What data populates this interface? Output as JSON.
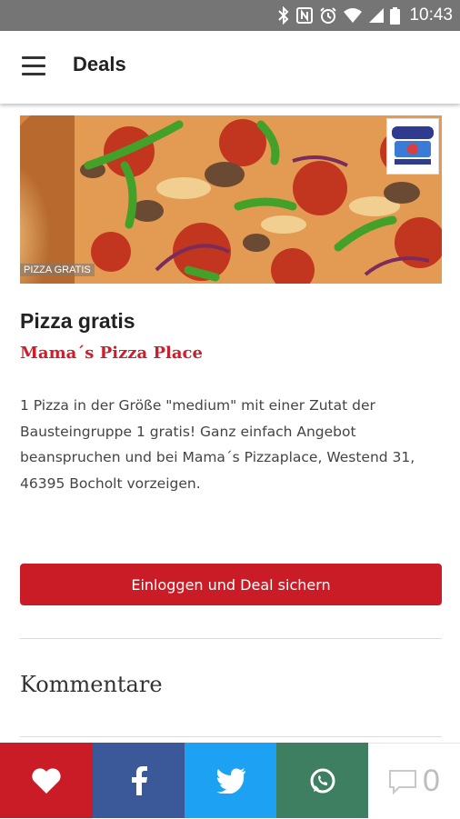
{
  "status_bar": {
    "time": "10:43"
  },
  "app_bar": {
    "title": "Deals"
  },
  "deal": {
    "image_tag": "PIZZA GRATIS",
    "title": "Pizza gratis",
    "merchant": "Mama´s Pizza Place",
    "description": "1 Pizza in der Größe \"medium\" mit einer Zutat der Bausteingruppe 1 gratis! Ganz einfach Angebot beanspruchen und bei Mama´s Pizzaplace, Westend 31, 46395 Bocholt vorzeigen.",
    "cta_label": "Einloggen und Deal sichern"
  },
  "comments": {
    "heading": "Kommentare",
    "count": "0"
  },
  "share_bar": {
    "items": [
      {
        "icon": "heart-icon",
        "color": "#c91c26"
      },
      {
        "icon": "facebook-icon",
        "color": "#3b5998"
      },
      {
        "icon": "twitter-icon",
        "color": "#1da1f2"
      },
      {
        "icon": "whatsapp-icon",
        "color": "#3d7f60"
      },
      {
        "icon": "comment-icon",
        "color": "#ffffff"
      }
    ]
  },
  "colors": {
    "accent": "#c91c26",
    "status_bar": "#757575"
  }
}
